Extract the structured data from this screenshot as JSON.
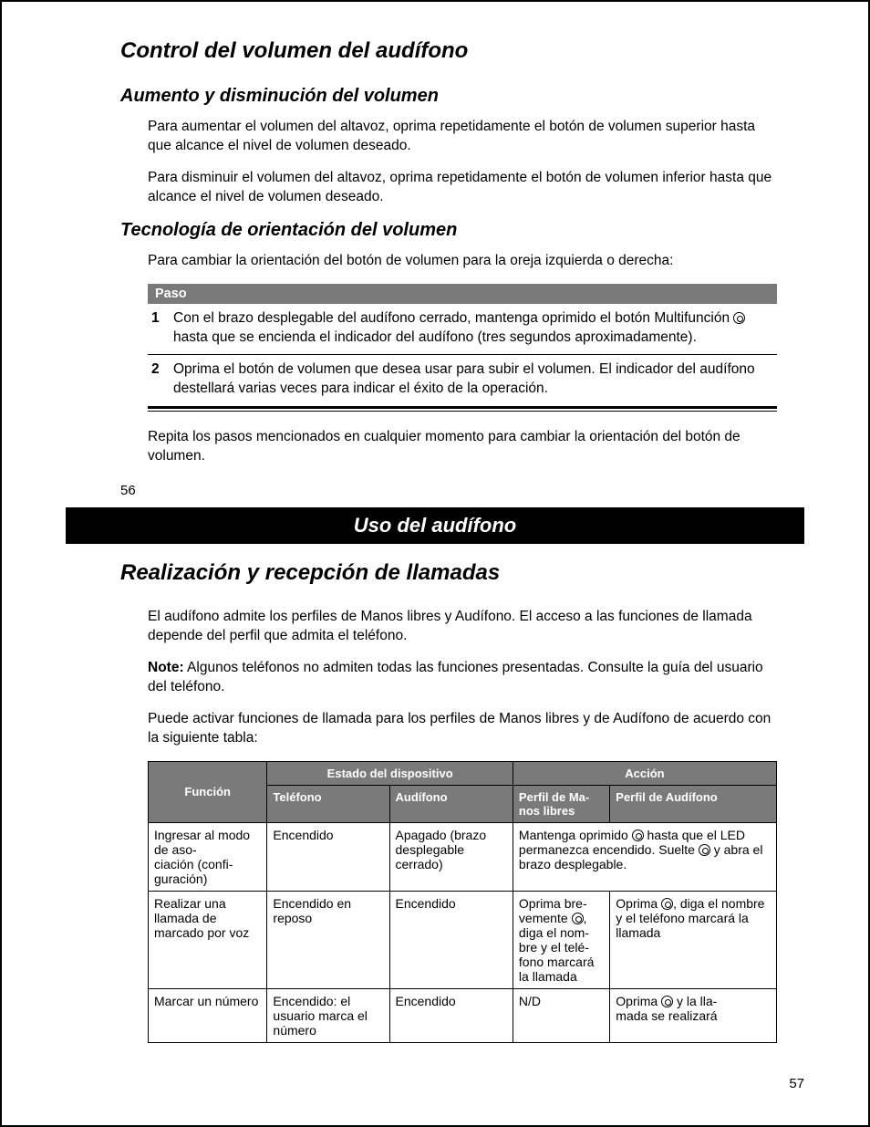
{
  "page56": {
    "h1": "Control del volumen del audífono",
    "h2a": "Aumento y disminución del volumen",
    "p1": "Para aumentar el volumen del altavoz, oprima repetidamente el botón de volumen superior hasta que alcance el nivel de volumen deseado.",
    "p2": "Para disminuir el volumen del altavoz, oprima repetidamente el botón de volumen inferior hasta que alcance el nivel de volumen deseado.",
    "h2b": "Tecnología de orientación del volumen",
    "p3": "Para cambiar la orientación del botón de volumen para la oreja izquierda o derecha:",
    "paso_label": "Paso",
    "steps": [
      {
        "n": "1",
        "t_before": "Con el brazo desplegable del audífono cerrado, mantenga oprimido el botón Multifunción ",
        "t_after": " hasta que se encienda el indicador del audífono (tres segundos aproximadamente)."
      },
      {
        "n": "2",
        "t": "Oprima el botón de volumen que desea usar para subir el volumen. El indicador del audífono destellará varias veces para indicar el éxito de la operación."
      }
    ],
    "p4": "Repita los pasos mencionados en cualquier momento para cambiar la orientación del botón de volumen.",
    "pagenum": "56"
  },
  "banner": "Uso del audífono",
  "page57": {
    "h1": "Realización y recepción de llamadas",
    "p1": "El audífono admite los perfiles de Manos libres y Audífono. El acceso a las funciones de llamada depende del perfil que admita el teléfono.",
    "note_label": "Note:",
    "note_text": " Algunos teléfonos no admiten todas las funciones presentadas. Consulte la guía del usuario del teléfono.",
    "p2": "Puede activar funciones de llamada para los perfiles de Manos libres y de Audífono de acuerdo con la siguiente tabla:",
    "thead": {
      "group_estado": "Estado del dispositivo",
      "group_accion": "Acción",
      "funcion": "Función",
      "telefono": "Teléfono",
      "audifono": "Audífono",
      "perfil_ml": "Perfil de Ma-\nnos libres",
      "perfil_aud": "Perfil de Audífono"
    },
    "rows": [
      {
        "funcion": "Ingresar al modo de aso-\nciación (confi-\nguración)",
        "telefono": "Encendido",
        "audifono": "Apagado (brazo desplegable cerrado)",
        "accion_before": "Mantenga oprimido ",
        "accion_mid": " hasta que el LED permanezca encendido. Suelte ",
        "accion_after": " y abra el brazo desplegable.",
        "merged": true
      },
      {
        "funcion": "Realizar una llamada de marcado por voz",
        "telefono": "Encendido en reposo",
        "audifono": "Encendido",
        "ml_before": "Oprima bre-\nvemente ",
        "ml_after": ", diga el nom-\nbre y el telé-\nfono marcará la llamada",
        "aud_before": "Oprima ",
        "aud_after": ", diga el nombre y el teléfono marcará la llamada"
      },
      {
        "funcion": "Marcar un número",
        "telefono": "Encendido: el usuario marca el número",
        "audifono": "Encendido",
        "ml": "N/D",
        "aud_before": "Oprima ",
        "aud_after": " y la lla-\nmada se realizará"
      }
    ],
    "pagenum": "57"
  }
}
